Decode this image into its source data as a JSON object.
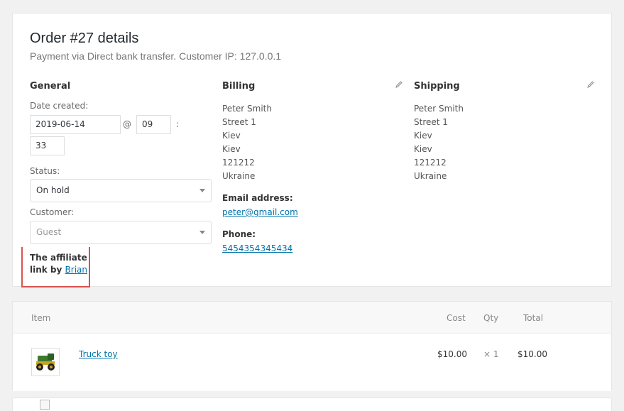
{
  "order": {
    "title": "Order #27 details",
    "subtitle": "Payment via Direct bank transfer. Customer IP: 127.0.0.1"
  },
  "general": {
    "heading": "General",
    "date_label": "Date created:",
    "date_value": "2019-06-14",
    "at_symbol": "@",
    "hour_value": "09",
    "colon": ":",
    "minute_value": "33",
    "status_label": "Status:",
    "status_value": "On hold",
    "customer_label": "Customer:",
    "customer_value": "Guest"
  },
  "affiliate": {
    "text_line1": "The affiliate",
    "text_prefix": "link by",
    "link_text": "Brian"
  },
  "billing": {
    "heading": "Billing",
    "edit_icon": "pencil-icon",
    "lines": [
      "Peter Smith",
      "Street 1",
      "Kiev",
      "Kiev",
      "121212",
      "Ukraine"
    ],
    "email_label": "Email address:",
    "email": "peter@gmail.com",
    "phone_label": "Phone:",
    "phone": "5454354345434"
  },
  "shipping": {
    "heading": "Shipping",
    "edit_icon": "pencil-icon",
    "lines": [
      "Peter Smith",
      "Street 1",
      "Kiev",
      "Kiev",
      "121212",
      "Ukraine"
    ]
  },
  "items": {
    "headers": {
      "item": "Item",
      "cost": "Cost",
      "qty": "Qty",
      "total": "Total"
    },
    "rows": [
      {
        "name": "Truck toy",
        "cost": "$10.00",
        "qty": "× 1",
        "total": "$10.00",
        "thumb_icon": "truck-toy-image"
      }
    ]
  },
  "colors": {
    "link": "#0073aa",
    "highlight_border": "#d9534f"
  }
}
